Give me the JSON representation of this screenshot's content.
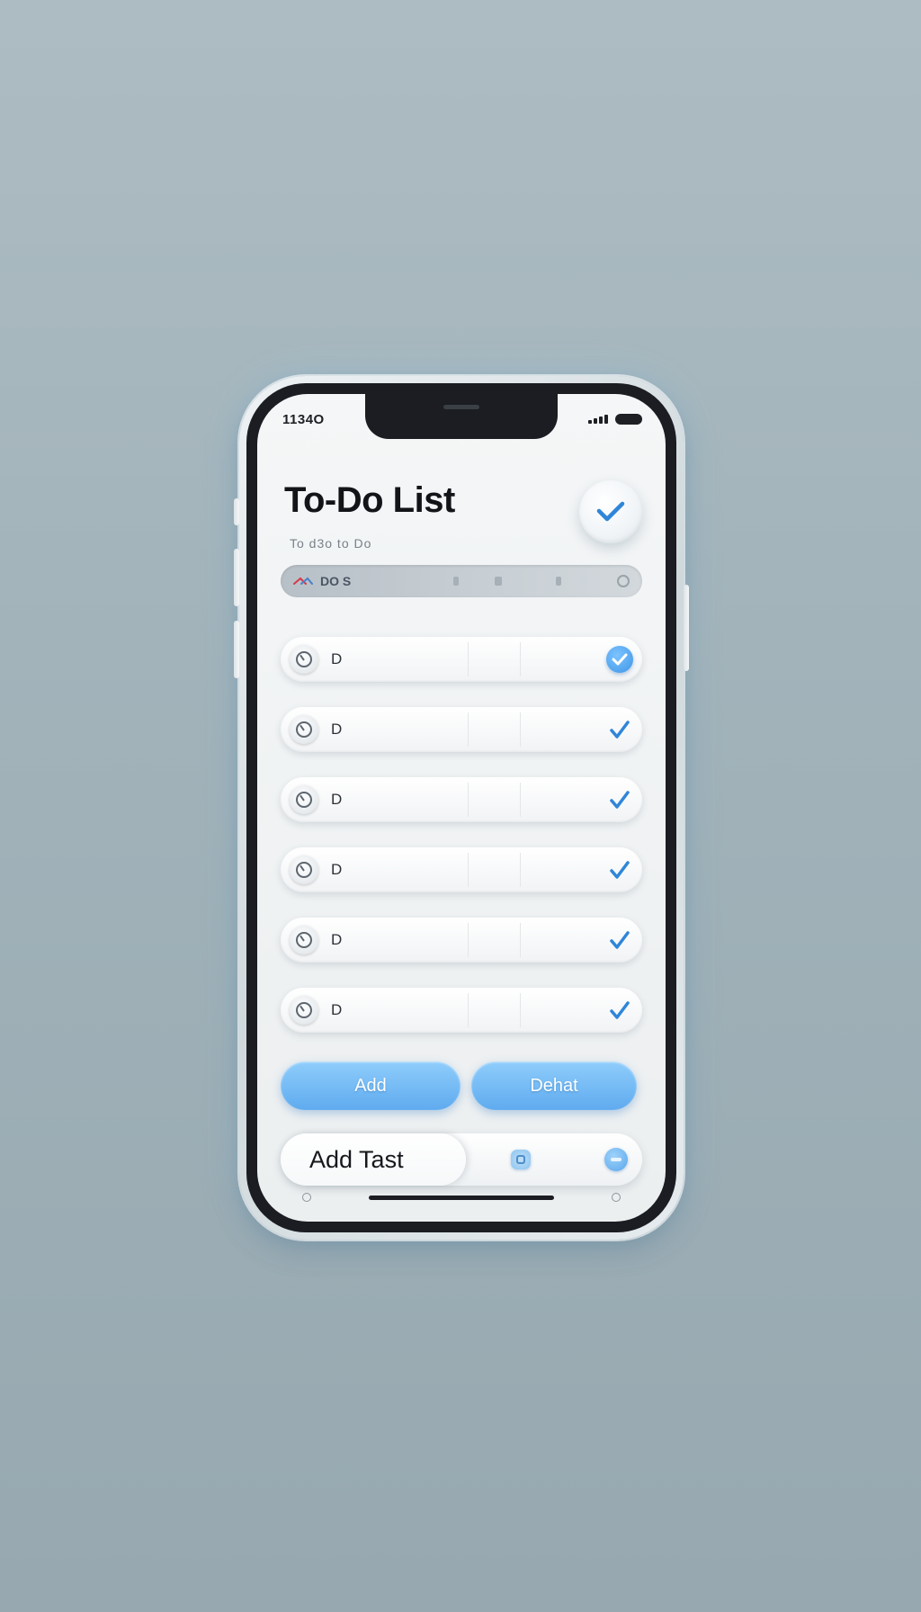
{
  "status_bar": {
    "time": "1134O"
  },
  "header": {
    "title": "To-Do List",
    "subtitle": "To d3o to Do"
  },
  "filter_bar": {
    "label": "DO S"
  },
  "tasks": [
    {
      "label": "D",
      "checked": true
    },
    {
      "label": "D",
      "checked": true
    },
    {
      "label": "D",
      "checked": true
    },
    {
      "label": "D",
      "checked": true
    },
    {
      "label": "D",
      "checked": true
    },
    {
      "label": "D",
      "checked": true
    }
  ],
  "actions": {
    "add_label": "Add",
    "delete_label": "Dehat"
  },
  "add_task": {
    "label": "Add Tast"
  },
  "colors": {
    "accent": "#5fabef",
    "check": "#2f86d8",
    "text": "#121418"
  }
}
